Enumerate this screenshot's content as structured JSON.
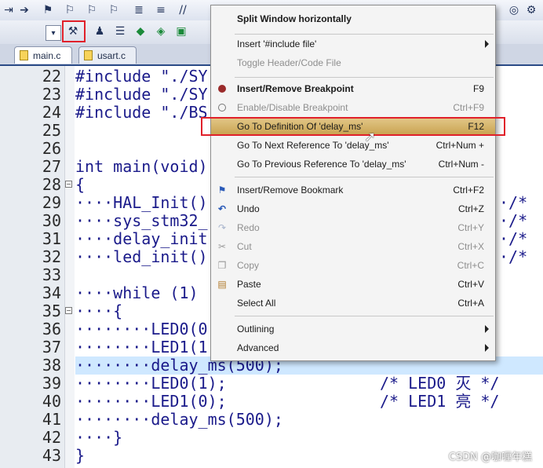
{
  "toolbar": {
    "row1_icons": [
      "arrow-right-icon",
      "flag-icon",
      "flag-prev-icon",
      "flag-next-icon",
      "clear-flags-icon",
      "indent-icon",
      "outdent-icon",
      "comment-icon"
    ],
    "row2_icons": [
      "dropdown-icon",
      "manage-components-icon",
      "download-icon",
      "options-icon",
      "build-icon",
      "pack-installer-icon",
      "manage-runtime-icon"
    ]
  },
  "tabs": [
    {
      "label": "main.c",
      "active": true
    },
    {
      "label": "usart.c",
      "active": false
    }
  ],
  "editor": {
    "lines": [
      {
        "n": "22",
        "text": "#include \"./SY"
      },
      {
        "n": "23",
        "text": "#include \"./SY"
      },
      {
        "n": "24",
        "text": "#include \"./BS"
      },
      {
        "n": "25",
        "text": ""
      },
      {
        "n": "26",
        "text": ""
      },
      {
        "n": "27",
        "text": "int main(void)"
      },
      {
        "n": "28",
        "text": "{"
      },
      {
        "n": "29",
        "text": "····HAL_Init()"
      },
      {
        "n": "30",
        "text": "····sys_stm32_"
      },
      {
        "n": "31",
        "text": "····delay_init"
      },
      {
        "n": "32",
        "text": "····led_init()"
      },
      {
        "n": "33",
        "text": ""
      },
      {
        "n": "34",
        "text": "····while (1)"
      },
      {
        "n": "35",
        "text": "····{"
      },
      {
        "n": "36",
        "text": "········LED0(0"
      },
      {
        "n": "37",
        "text": "········LED1(1"
      },
      {
        "n": "38",
        "text": "········delay_ms(500);"
      },
      {
        "n": "39",
        "text": "········LED0(1);"
      },
      {
        "n": "40",
        "text": "········LED1(0);"
      },
      {
        "n": "41",
        "text": "········delay_ms(500);"
      },
      {
        "n": "42",
        "text": "····}"
      },
      {
        "n": "43",
        "text": "}"
      }
    ],
    "right_fragments": {
      "l29": "·/*",
      "l30": "·/*",
      "l31": "·/*",
      "l32": "·/*",
      "l39": "/* LED0 灭 */",
      "l40": "/* LED1 亮 */"
    }
  },
  "context_menu": {
    "items": [
      {
        "label": "Split Window horizontally",
        "shortcut": "",
        "icon": "",
        "state": "bold"
      },
      {
        "label": "Insert '#include file'",
        "shortcut": "",
        "icon": "",
        "state": "normal",
        "submenu": true
      },
      {
        "label": "Toggle Header/Code File",
        "shortcut": "",
        "icon": "",
        "state": "disabled"
      },
      {
        "label": "Insert/Remove Breakpoint",
        "shortcut": "F9",
        "icon": "breakpoint-icon",
        "state": "bold"
      },
      {
        "label": "Enable/Disable Breakpoint",
        "shortcut": "Ctrl+F9",
        "icon": "breakpoint-outline-icon",
        "state": "disabled"
      },
      {
        "label": "Go To Definition Of 'delay_ms'",
        "shortcut": "F12",
        "icon": "",
        "state": "hover"
      },
      {
        "label": "Go To Next Reference To 'delay_ms'",
        "shortcut": "Ctrl+Num +",
        "icon": "",
        "state": "normal"
      },
      {
        "label": "Go To Previous Reference To 'delay_ms'",
        "shortcut": "Ctrl+Num -",
        "icon": "",
        "state": "normal"
      },
      {
        "label": "Insert/Remove Bookmark",
        "shortcut": "Ctrl+F2",
        "icon": "bookmark-flag-icon",
        "state": "normal"
      },
      {
        "label": "Undo",
        "shortcut": "Ctrl+Z",
        "icon": "undo-icon",
        "state": "normal"
      },
      {
        "label": "Redo",
        "shortcut": "Ctrl+Y",
        "icon": "redo-icon",
        "state": "disabled"
      },
      {
        "label": "Cut",
        "shortcut": "Ctrl+X",
        "icon": "cut-icon",
        "state": "disabled"
      },
      {
        "label": "Copy",
        "shortcut": "Ctrl+C",
        "icon": "copy-icon",
        "state": "disabled"
      },
      {
        "label": "Paste",
        "shortcut": "Ctrl+V",
        "icon": "paste-icon",
        "state": "normal"
      },
      {
        "label": "Select All",
        "shortcut": "Ctrl+A",
        "icon": "",
        "state": "normal"
      },
      {
        "label": "Outlining",
        "shortcut": "",
        "icon": "",
        "state": "normal",
        "submenu": true
      },
      {
        "label": "Advanced",
        "shortcut": "",
        "icon": "",
        "state": "normal",
        "submenu": true
      }
    ]
  },
  "watermark": "CSDN @咖喱年糕",
  "colors": {
    "highlight_red": "#e0202a",
    "menu_hover": "#c9a24f",
    "code_text": "#1a1a8a",
    "current_line": "#cfe8ff"
  }
}
